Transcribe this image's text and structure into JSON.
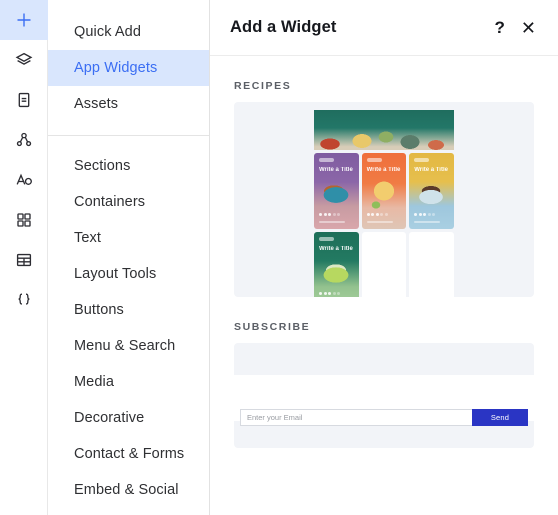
{
  "icon_rail": {
    "items": [
      {
        "name": "add-icon",
        "active": true
      },
      {
        "name": "layers-icon",
        "active": false
      },
      {
        "name": "pages-icon",
        "active": false
      },
      {
        "name": "site-structure-icon",
        "active": false
      },
      {
        "name": "design-theme-icon",
        "active": false
      },
      {
        "name": "apps-grid-icon",
        "active": false
      },
      {
        "name": "cms-table-icon",
        "active": false
      },
      {
        "name": "custom-code-icon",
        "active": false
      }
    ]
  },
  "menu": {
    "group_one": [
      {
        "label": "Quick Add",
        "selected": false
      },
      {
        "label": "App Widgets",
        "selected": true
      },
      {
        "label": "Assets",
        "selected": false
      }
    ],
    "group_two": [
      {
        "label": "Sections"
      },
      {
        "label": "Containers"
      },
      {
        "label": "Text"
      },
      {
        "label": "Layout Tools"
      },
      {
        "label": "Buttons"
      },
      {
        "label": "Menu & Search"
      },
      {
        "label": "Media"
      },
      {
        "label": "Decorative"
      },
      {
        "label": "Contact & Forms"
      },
      {
        "label": "Embed & Social"
      }
    ]
  },
  "panel": {
    "title": "Add a Widget",
    "help_icon": "?",
    "close_icon": "✕",
    "sections": [
      {
        "label": "RECIPES"
      },
      {
        "label": "SUBSCRIBE"
      }
    ]
  },
  "recipes_widget": {
    "cards": [
      {
        "title": "Write a Title",
        "color": "purple",
        "rating_filled": 3,
        "rating_total": 5
      },
      {
        "title": "Write a Title",
        "color": "orange",
        "rating_filled": 3,
        "rating_total": 5
      },
      {
        "title": "Write a Title",
        "color": "yellow",
        "rating_filled": 3,
        "rating_total": 5
      },
      {
        "title": "Write a Title",
        "color": "green",
        "rating_filled": 3,
        "rating_total": 5
      }
    ]
  },
  "subscribe_widget": {
    "email_placeholder": "Enter your Email",
    "email_value": "",
    "send_label": "Send",
    "send_color": "#2a35c4"
  },
  "colors": {
    "accent_blue": "#3b6ef3",
    "selected_row_bg": "#d9e6fd",
    "preview_bg": "#f2f4f8",
    "text_primary": "#2f3033"
  }
}
